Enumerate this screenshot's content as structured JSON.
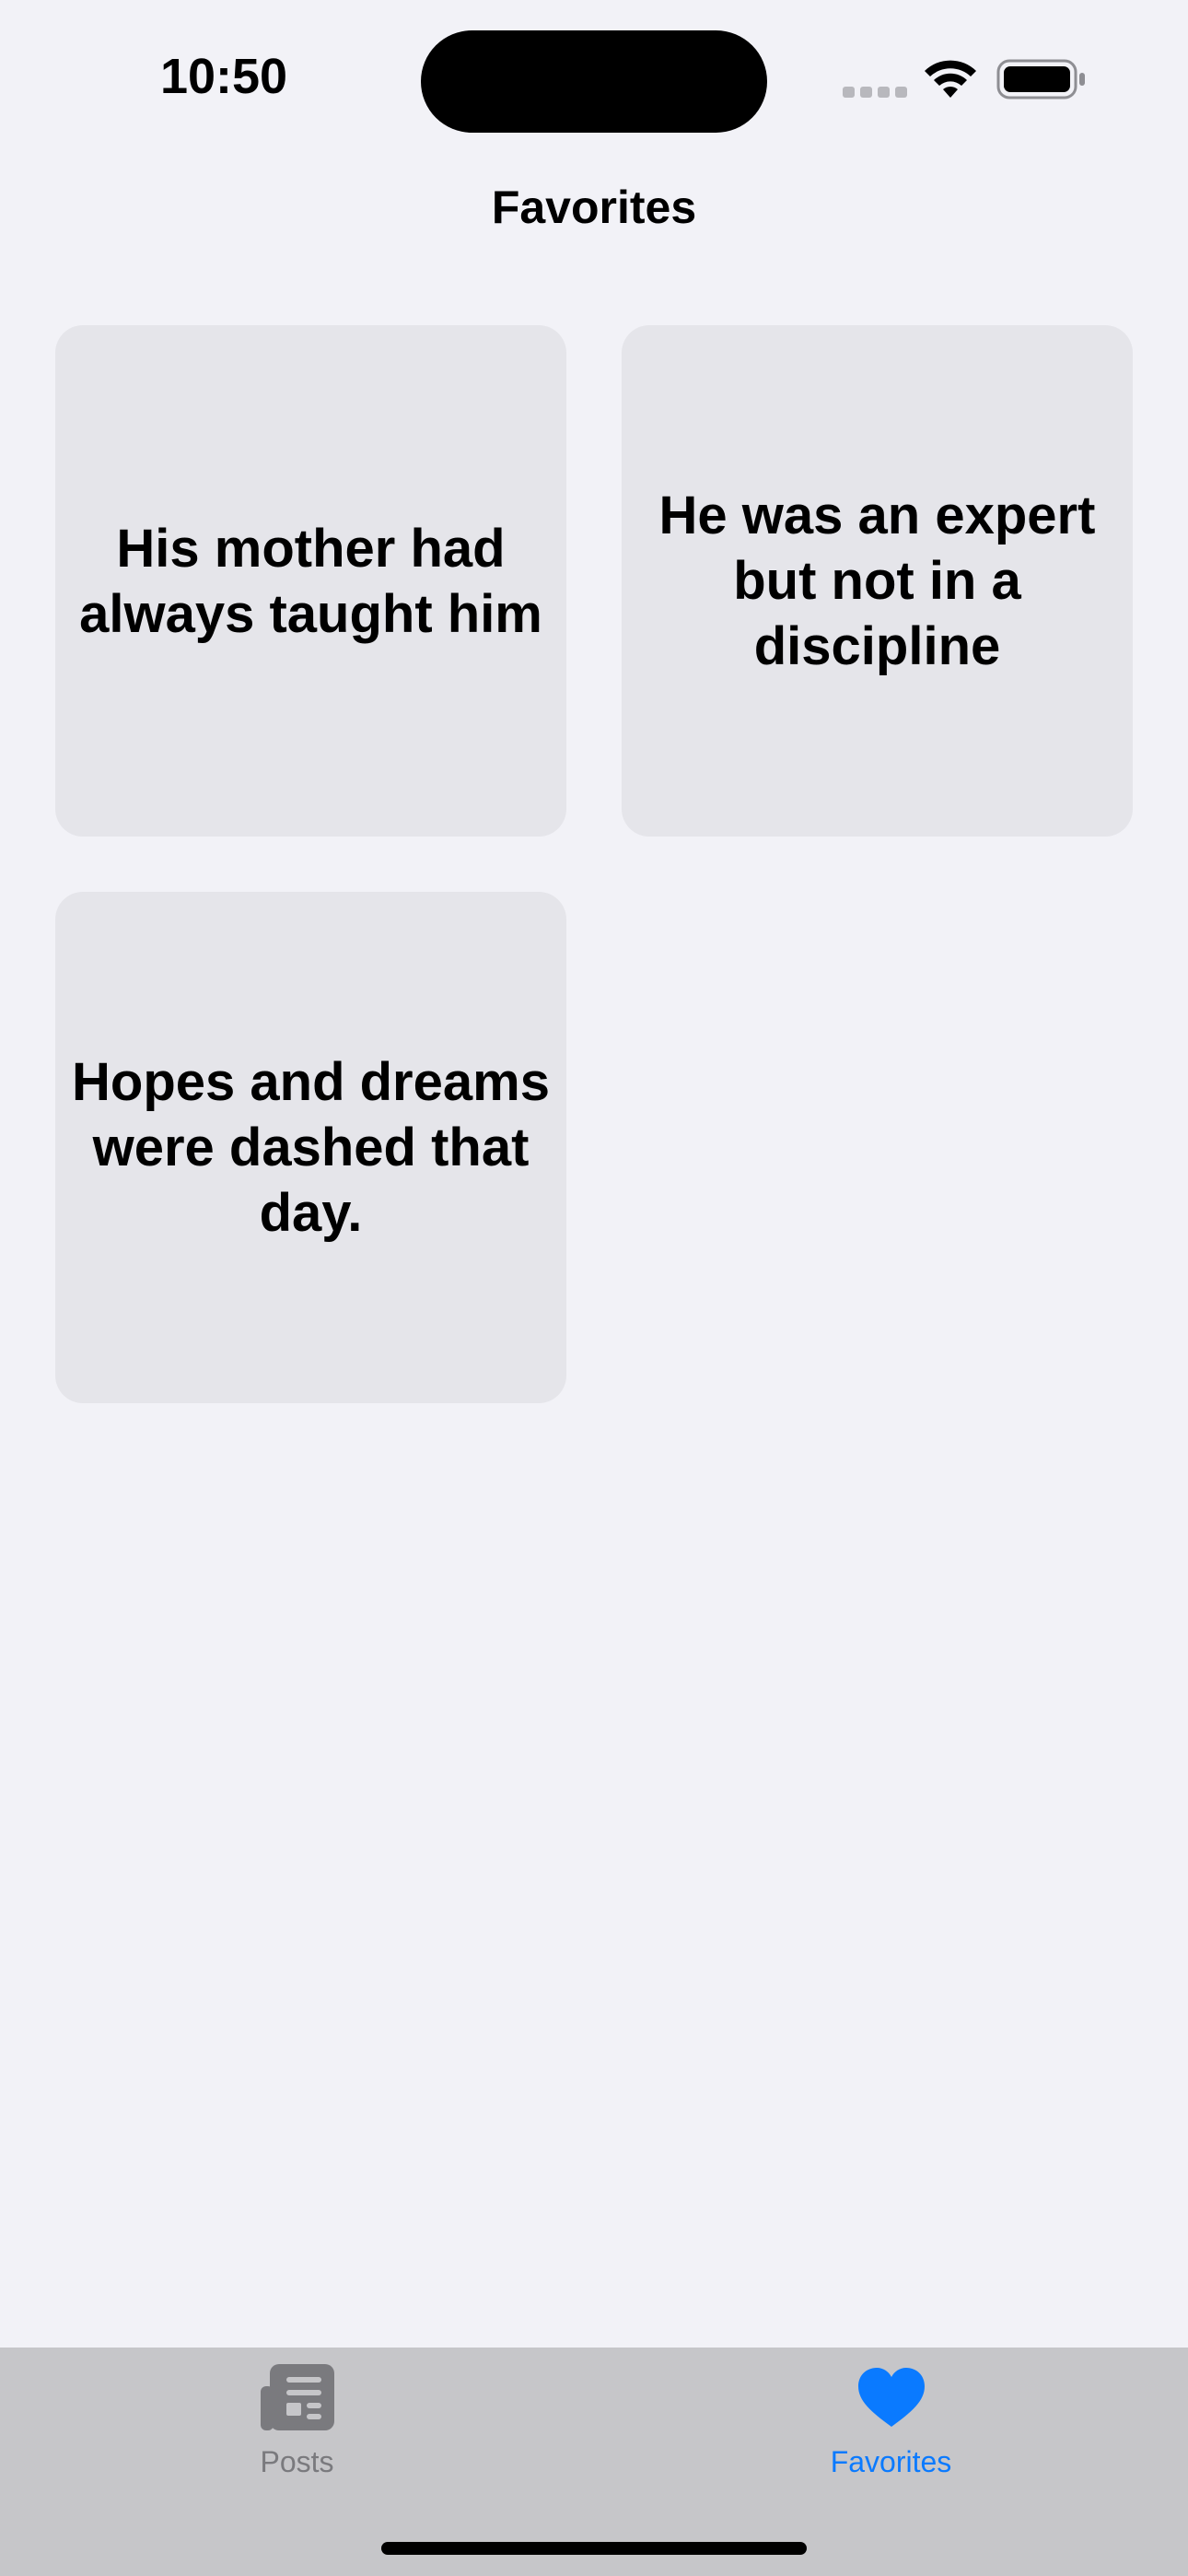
{
  "status_bar": {
    "time": "10:50"
  },
  "nav": {
    "title": "Favorites"
  },
  "favorites": [
    {
      "text": "His mother had always taught him"
    },
    {
      "text": "He was an expert but not in a discipline"
    },
    {
      "text": "Hopes and dreams were dashed that day."
    }
  ],
  "tab_bar": {
    "tabs": [
      {
        "label": "Posts",
        "icon": "newspaper-icon",
        "selected": false
      },
      {
        "label": "Favorites",
        "icon": "heart-icon",
        "selected": true
      }
    ]
  },
  "colors": {
    "background": "#f2f2f7",
    "card": "#e5e5ea",
    "tab_bar": "#c6c6c9",
    "accent": "#0a7aff",
    "inactive": "#7a7a7e"
  }
}
